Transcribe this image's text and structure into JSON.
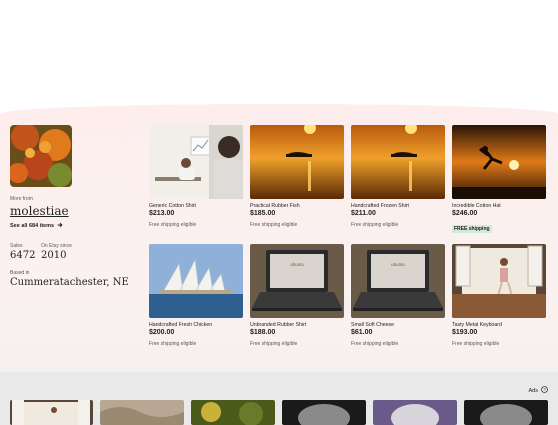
{
  "shop": {
    "more_from": "More from",
    "name": "molestiae",
    "see_all": "See all 684 items",
    "sales_label": "Sales",
    "sales_value": "6472",
    "since_label": "On Etsy since",
    "since_value": "2010",
    "based_label": "Based in",
    "based_value": "Cummeratachester, NE"
  },
  "items": [
    {
      "title": "Generic Cotton Shirt",
      "price": "$213.00",
      "shipping": "Free shipping eligible",
      "image": "office-man"
    },
    {
      "title": "Practical Rubber Fish",
      "price": "$185.00",
      "shipping": "Free shipping eligible",
      "image": "sunset-island"
    },
    {
      "title": "Handcrafted Frozen Shirt",
      "price": "$211.00",
      "shipping": "Free shipping eligible",
      "image": "sunset-island"
    },
    {
      "title": "Incredible Cotton Hat",
      "price": "$246.00",
      "shipping": "FREE shipping",
      "image": "sunset-soccer"
    },
    {
      "title": "Handcrafted Fresh Chicken",
      "price": "$200.00",
      "shipping": "Free shipping eligible",
      "image": "opera-house"
    },
    {
      "title": "Unbranded Rubber Shirt",
      "price": "$188.00",
      "shipping": "Free shipping eligible",
      "image": "ubuntu-laptop"
    },
    {
      "title": "Small Soft Cheese",
      "price": "$61.00",
      "shipping": "Free shipping eligible",
      "image": "ubuntu-laptop"
    },
    {
      "title": "Tasty Metal Keyboard",
      "price": "$193.00",
      "shipping": "Free shipping eligible",
      "image": "woman-window"
    }
  ],
  "laptop_brand": "ubuntu",
  "ads_label": "Ads",
  "icons": {
    "arrow": "arrow-right-icon",
    "info": "info-icon"
  },
  "colors": {
    "badge_bg": "#d4e9d7",
    "panel_bg": "#fdeeed"
  }
}
